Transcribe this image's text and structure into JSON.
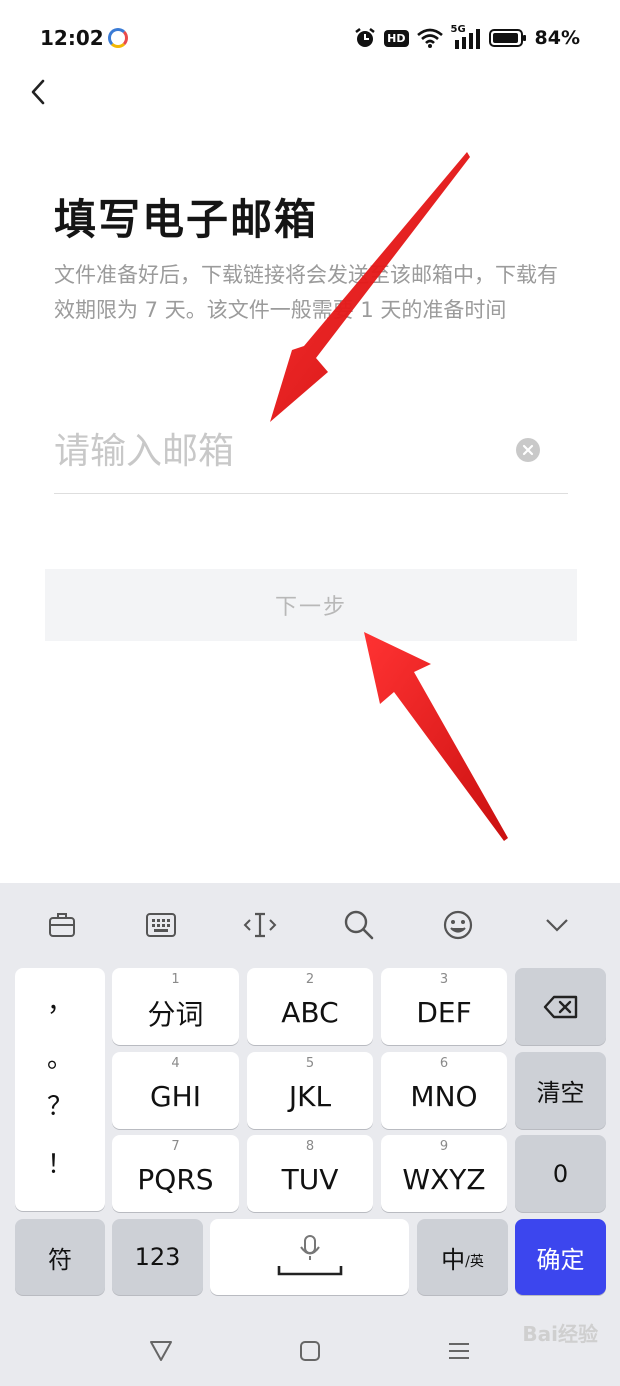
{
  "status_bar": {
    "time": "12:02",
    "hd": "HD",
    "network": "5G",
    "battery": "84%"
  },
  "page": {
    "title": "填写电子邮箱",
    "description": "文件准备好后，下载链接将会发送至该邮箱中，下载有效期限为 7 天。该文件一般需要 1 天的准备时间",
    "email_placeholder": "请输入邮箱",
    "email_value": "",
    "next_label": "下一步"
  },
  "keyboard": {
    "punctuation": [
      "，",
      "。",
      "？",
      "！"
    ],
    "row1": [
      {
        "num": "1",
        "label": "分词"
      },
      {
        "num": "2",
        "label": "ABC"
      },
      {
        "num": "3",
        "label": "DEF"
      }
    ],
    "row2": [
      {
        "num": "4",
        "label": "GHI"
      },
      {
        "num": "5",
        "label": "JKL"
      },
      {
        "num": "6",
        "label": "MNO"
      }
    ],
    "row3": [
      {
        "num": "7",
        "label": "PQRS"
      },
      {
        "num": "8",
        "label": "TUV"
      },
      {
        "num": "9",
        "label": "WXYZ"
      }
    ],
    "clear_label": "清空",
    "zero_label": "0",
    "symbol_label": "符",
    "numeric_label": "123",
    "lang_label_main": "中",
    "lang_label_sub": "/英",
    "confirm_label": "确定"
  },
  "colors": {
    "accent_blue": "#3c46ee",
    "arrow_red": "#e81414"
  },
  "watermark": "Bai经验"
}
